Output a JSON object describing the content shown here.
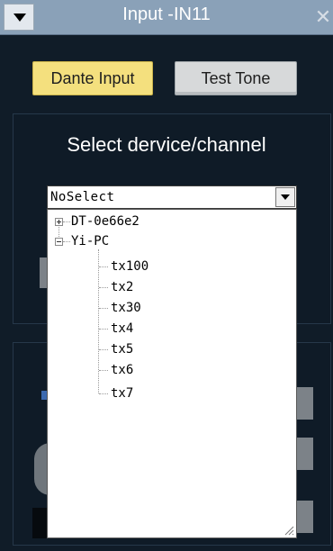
{
  "window": {
    "title": "Input -IN11"
  },
  "buttons": {
    "dante": "Dante Input",
    "test_tone": "Test Tone"
  },
  "panel": {
    "heading": "Select dervice/channel"
  },
  "combo": {
    "value": "NoSelect"
  },
  "tree": {
    "devices": [
      {
        "label": "DT-0e66e2",
        "expanded": false,
        "channels": []
      },
      {
        "label": "Yi-PC",
        "expanded": true,
        "channels": [
          "tx100",
          "tx2",
          "tx30",
          "tx4",
          "tx5",
          "tx6",
          "tx7"
        ]
      }
    ]
  },
  "colors": {
    "background": "#101c28",
    "titlebar": "#8aa1b8",
    "dante_button": "#f4e07e",
    "test_tone_button": "#d7d9da"
  },
  "icons": {
    "window_menu": "triangle-down-icon",
    "close": "close-icon",
    "combo_arrow": "chevron-down-icon",
    "resize": "resize-grip-icon"
  }
}
